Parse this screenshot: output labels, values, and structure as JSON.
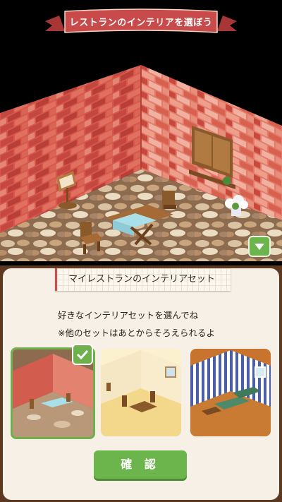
{
  "banner": {
    "title": "レストランのインテリアを選ぼう"
  },
  "panel": {
    "section_title": "マイレストランのインテリアセット",
    "instruction_1": "好きなインテリアセットを選んでね",
    "instruction_2": "※他のセットはあとからそろえられるよ",
    "sets": [
      {
        "icon": "brick-restaurant-thumbnail",
        "selected": true
      },
      {
        "icon": "cream-cafe-thumbnail",
        "selected": false
      },
      {
        "icon": "striped-lounge-thumbnail",
        "selected": false
      }
    ],
    "confirm_label": "確 認"
  },
  "colors": {
    "banner": "#c94a4a",
    "accent_green": "#6cb44c",
    "panel_border": "#5c3820"
  }
}
